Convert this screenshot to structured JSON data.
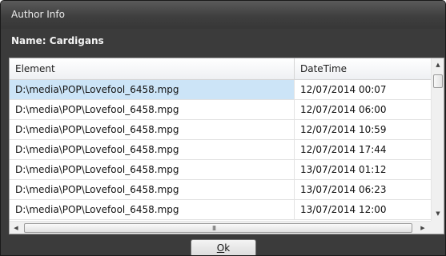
{
  "window": {
    "title": "Author Info"
  },
  "name_row": {
    "text": "Name: Cardigans"
  },
  "grid": {
    "columns": [
      "Element",
      "DateTime"
    ],
    "rows": [
      {
        "element": "D:\\media\\POP\\Lovefool_6458.mpg",
        "datetime": "12/07/2014 00:07",
        "selected": true
      },
      {
        "element": "D:\\media\\POP\\Lovefool_6458.mpg",
        "datetime": "12/07/2014 06:00"
      },
      {
        "element": "D:\\media\\POP\\Lovefool_6458.mpg",
        "datetime": "12/07/2014 10:59"
      },
      {
        "element": "D:\\media\\POP\\Lovefool_6458.mpg",
        "datetime": "12/07/2014 17:44"
      },
      {
        "element": "D:\\media\\POP\\Lovefool_6458.mpg",
        "datetime": "13/07/2014 01:12"
      },
      {
        "element": "D:\\media\\POP\\Lovefool_6458.mpg",
        "datetime": "13/07/2014 06:23"
      },
      {
        "element": "D:\\media\\POP\\Lovefool_6458.mpg",
        "datetime": "13/07/2014 12:00"
      }
    ],
    "scroll_icons": {
      "up": "triangle-up-icon",
      "down": "triangle-down-icon",
      "left": "triangle-left-icon",
      "right": "triangle-right-icon",
      "grip": "III"
    }
  },
  "buttons": {
    "ok_label": "Ok",
    "ok_mnemonic": "O",
    "ok_rest": "k"
  },
  "colors": {
    "dialog_bg": "#3b3b3b",
    "selection": "#cce4f7"
  }
}
